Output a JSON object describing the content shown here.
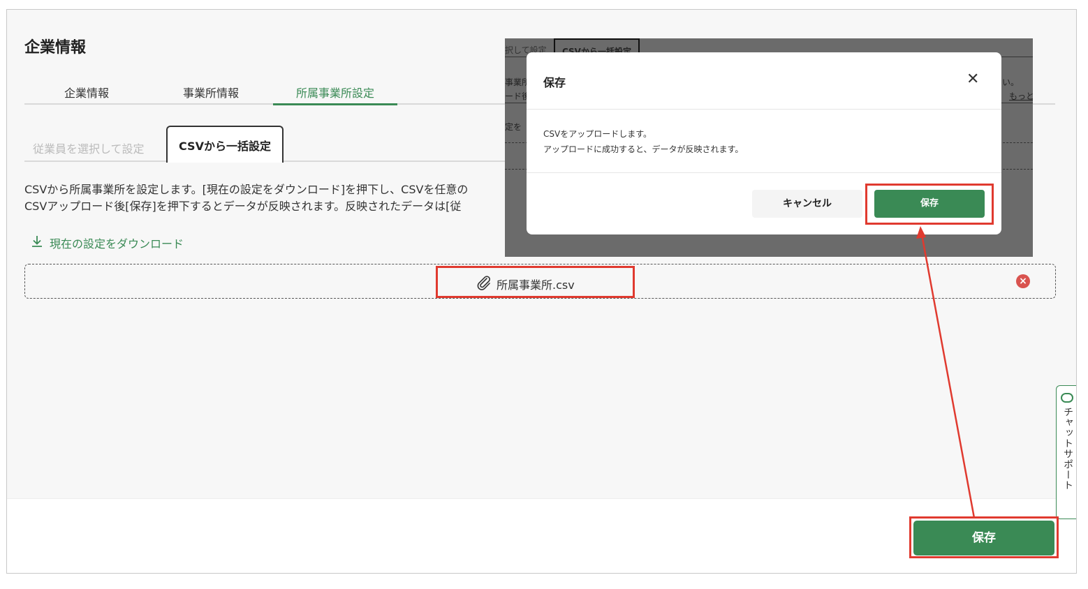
{
  "page": {
    "title": "企業情報"
  },
  "tabs": [
    {
      "label": "企業情報"
    },
    {
      "label": "事業所情報"
    },
    {
      "label": "所属事業所設定"
    }
  ],
  "subtabs": {
    "inactive_label": "従業員を選択して設定",
    "active_label": "CSVから一括設定"
  },
  "description": {
    "line1": "CSVから所属事業所を設定します。[現在の設定をダウンロード]を押下し、CSVを任意の",
    "line2": "CSVアップロード後[保存]を押下するとデータが反映されます。反映されたデータは[従"
  },
  "download_link": {
    "label": "現在の設定をダウンロード"
  },
  "upload": {
    "file_name": "所属事業所.csv"
  },
  "footer": {
    "save_label": "保存"
  },
  "chat_support": {
    "label": "チャットサポート"
  },
  "background_snippet": {
    "tab_partial": "択して設定",
    "tab_active": "CSVから一括設定",
    "row1_left": "事業所",
    "row2_left": "ード後",
    "row1_right": "い。",
    "row2_right": "もっと",
    "row3_left": "定を"
  },
  "modal": {
    "title": "保存",
    "body_line1": "CSVをアップロードします。",
    "body_line2": "アップロードに成功すると、データが反映されます。",
    "cancel_label": "キャンセル",
    "save_label": "保存"
  },
  "colors": {
    "accent": "#3a8a55",
    "highlight": "#e03a2f",
    "danger": "#d9534f"
  }
}
